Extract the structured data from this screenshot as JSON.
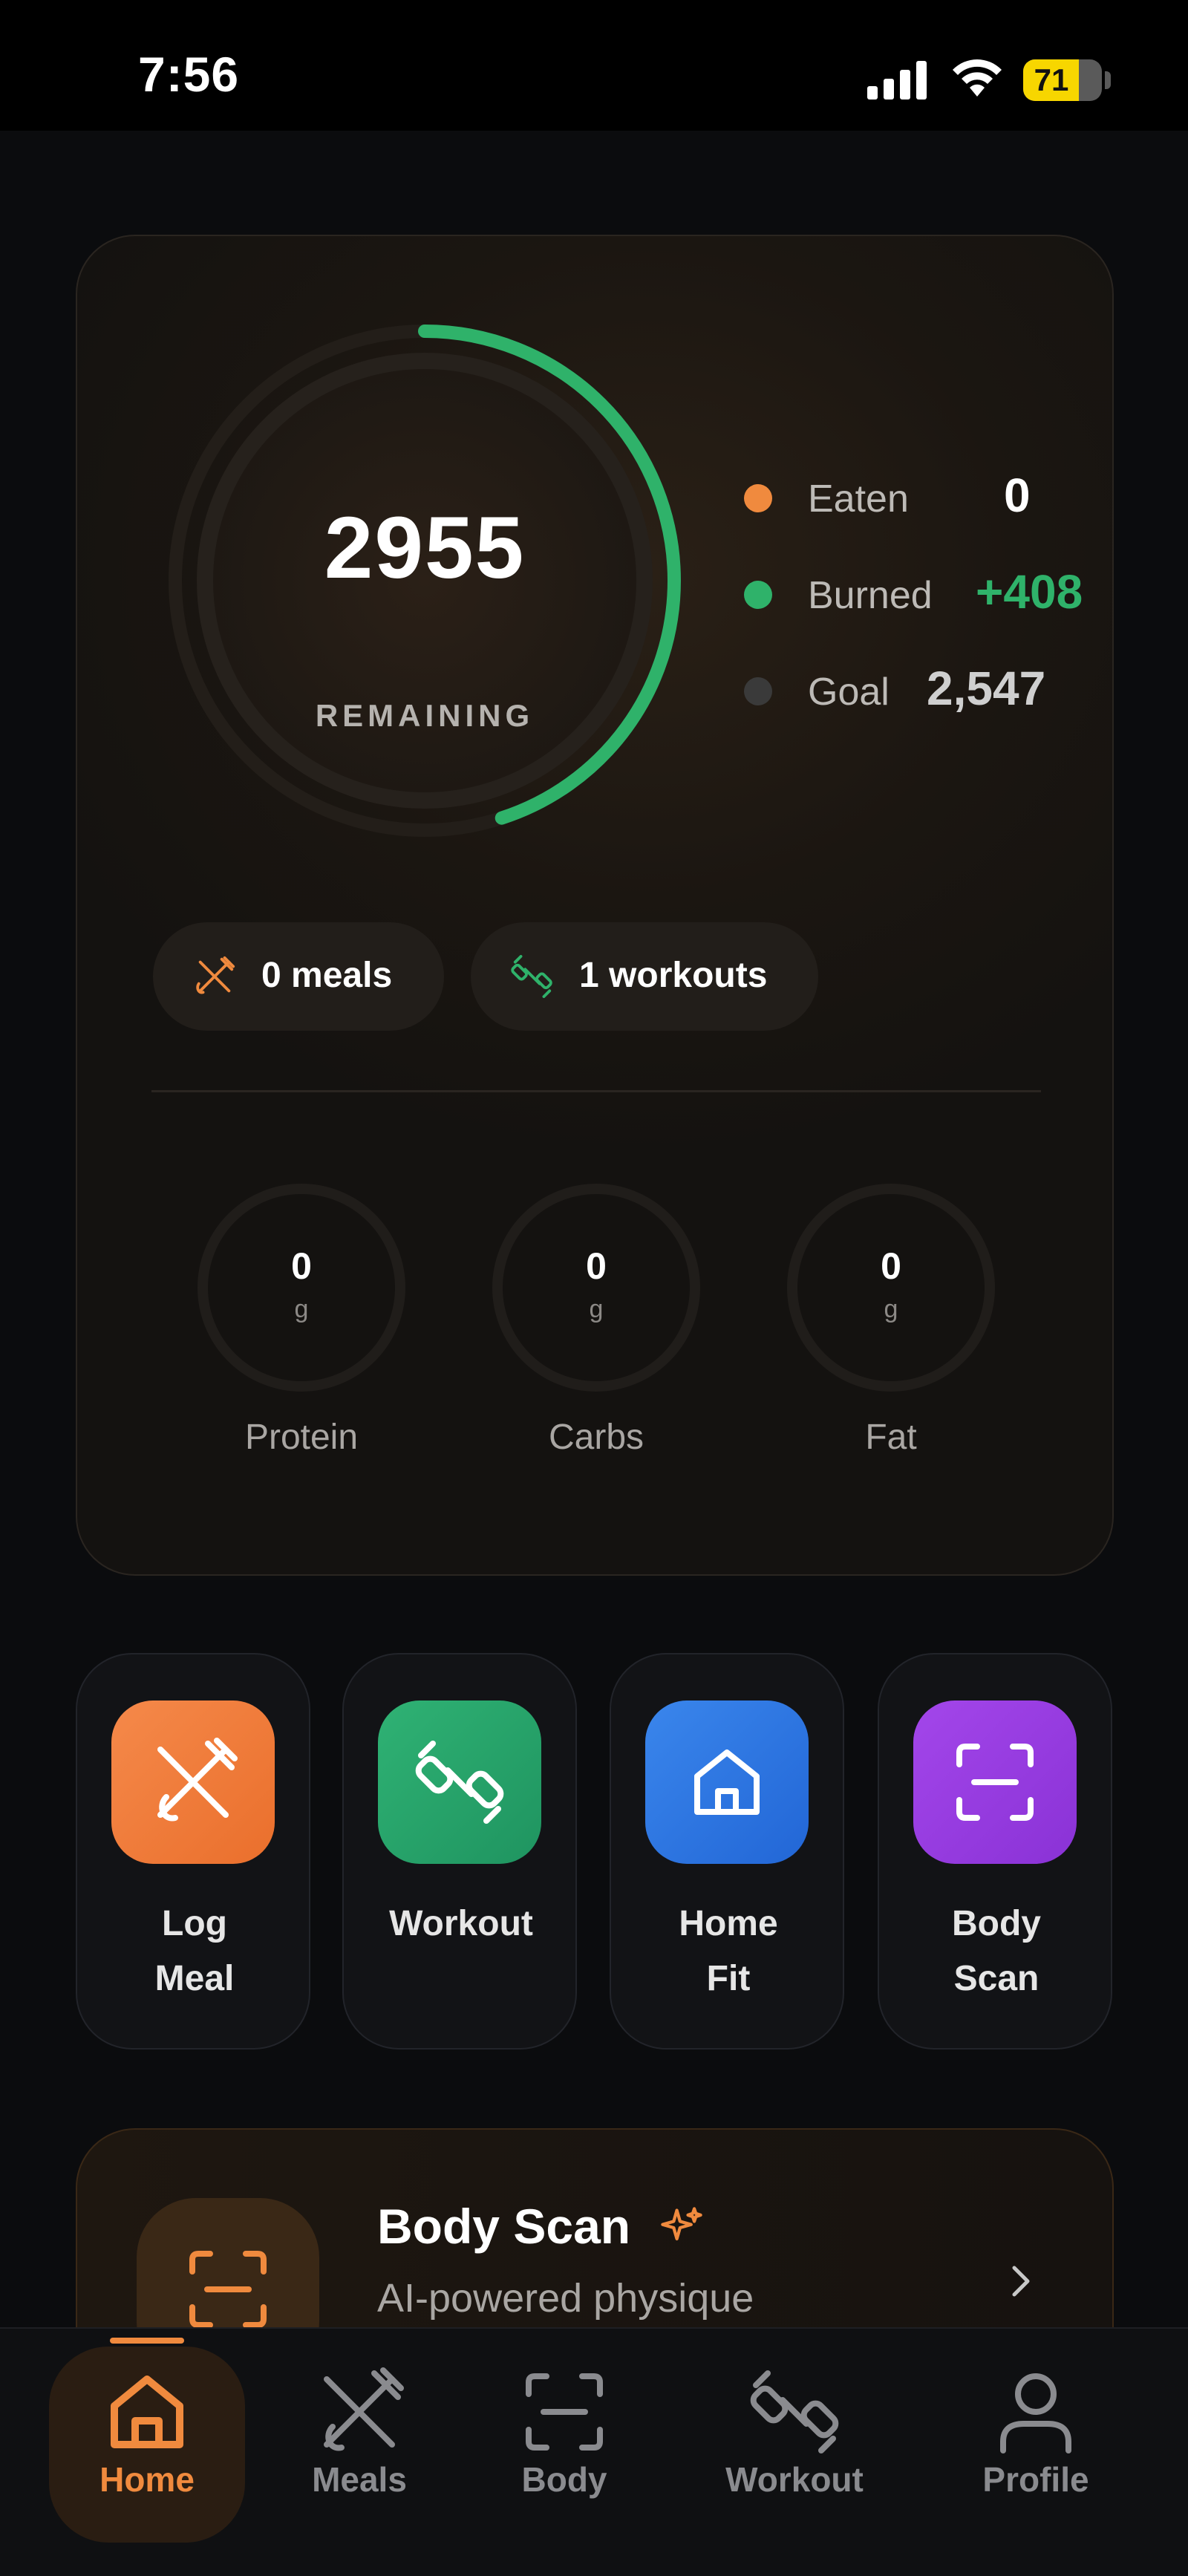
{
  "status_bar": {
    "time": "7:56",
    "battery": "71",
    "battery_level": 0.71
  },
  "summary": {
    "remaining_value": "2955",
    "remaining_label": "REMAINING",
    "burn_progress": 0.45,
    "stats": [
      {
        "label": "Eaten",
        "value": "0",
        "color": "#f08a3e",
        "value_color": "#ffffff"
      },
      {
        "label": "Burned",
        "value": "+408",
        "color": "#2fb26a",
        "value_color": "#2fb26a"
      },
      {
        "label": "Goal",
        "value": "2,547",
        "color": "#3a3a3a",
        "value_color": "#cfcfcf"
      }
    ],
    "chips": [
      {
        "label": "0 meals",
        "icon": "fork-knife-crossed-icon"
      },
      {
        "label": "1 workouts",
        "icon": "dumbbell-icon"
      }
    ],
    "macros": [
      {
        "value": "0",
        "unit": "g",
        "label": "Protein"
      },
      {
        "value": "0",
        "unit": "g",
        "label": "Carbs"
      },
      {
        "value": "0",
        "unit": "g",
        "label": "Fat"
      }
    ]
  },
  "quick_actions": [
    {
      "line1": "Log",
      "line2": "Meal",
      "color": "#f07a35",
      "icon": "fork-knife-icon"
    },
    {
      "line1": "Workout",
      "line2": "",
      "color": "#27a36a",
      "icon": "dumbbell-icon"
    },
    {
      "line1": "Home",
      "line2": "Fit",
      "color": "#2f7ae0",
      "icon": "home-icon"
    },
    {
      "line1": "Body",
      "line2": "Scan",
      "color": "#9a3ee0",
      "icon": "scan-icon"
    }
  ],
  "banner": {
    "title": "Body Scan",
    "subtitle": "AI-powered physique",
    "accent": "#f08a3e"
  },
  "tabs": [
    {
      "label": "Home",
      "icon": "home-icon",
      "active": true
    },
    {
      "label": "Meals",
      "icon": "fork-knife-icon",
      "active": false
    },
    {
      "label": "Body",
      "icon": "scan-icon",
      "active": false
    },
    {
      "label": "Workout",
      "icon": "dumbbell-icon",
      "active": false
    },
    {
      "label": "Profile",
      "icon": "profile-icon",
      "active": false
    }
  ],
  "colors": {
    "accent_orange": "#f08a3e",
    "accent_green": "#2fb26a",
    "tab_inactive": "#8a8b8f"
  }
}
